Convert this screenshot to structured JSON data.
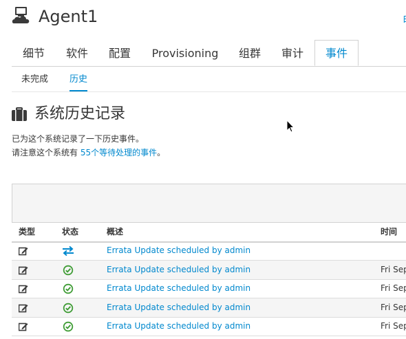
{
  "header": {
    "title": "Agent1",
    "icon": "server-cloud-icon",
    "corner_link": "白"
  },
  "tabs": [
    {
      "label": "细节",
      "active": false
    },
    {
      "label": "软件",
      "active": false
    },
    {
      "label": "配置",
      "active": false
    },
    {
      "label": "Provisioning",
      "active": false
    },
    {
      "label": "组群",
      "active": false
    },
    {
      "label": "审计",
      "active": false
    },
    {
      "label": "事件",
      "active": true
    }
  ],
  "subtabs": [
    {
      "label": "未完成",
      "active": false
    },
    {
      "label": "历史",
      "active": true
    }
  ],
  "section": {
    "title": "系统历史记录",
    "icon": "briefcase-icon",
    "line1": "已为这个系统记录了一下历史事件。",
    "line2_prefix": "请注意这个系统有 ",
    "line2_link": "55个等待处理的事件",
    "line2_suffix": "。"
  },
  "table": {
    "headers": {
      "type": "类型",
      "status": "状态",
      "summary": "概述",
      "time": "时间"
    },
    "rows": [
      {
        "type_icon": "edit-icon",
        "status_icon": "transfer-icon",
        "summary": "Errata Update scheduled by admin",
        "time": ""
      },
      {
        "type_icon": "edit-icon",
        "status_icon": "check-circle-icon",
        "summary": "Errata Update scheduled by admin",
        "time": "Fri Sep"
      },
      {
        "type_icon": "edit-icon",
        "status_icon": "check-circle-icon",
        "summary": "Errata Update scheduled by admin",
        "time": "Fri Sep"
      },
      {
        "type_icon": "edit-icon",
        "status_icon": "check-circle-icon",
        "summary": "Errata Update scheduled by admin",
        "time": "Fri Sep"
      },
      {
        "type_icon": "edit-icon",
        "status_icon": "check-circle-icon",
        "summary": "Errata Update scheduled by admin",
        "time": "Fri Sep"
      }
    ]
  },
  "colors": {
    "accent": "#0088ce",
    "success": "#3f9c35",
    "text": "#363636",
    "border": "#d1d1d1",
    "stripe": "#f5f5f5"
  }
}
